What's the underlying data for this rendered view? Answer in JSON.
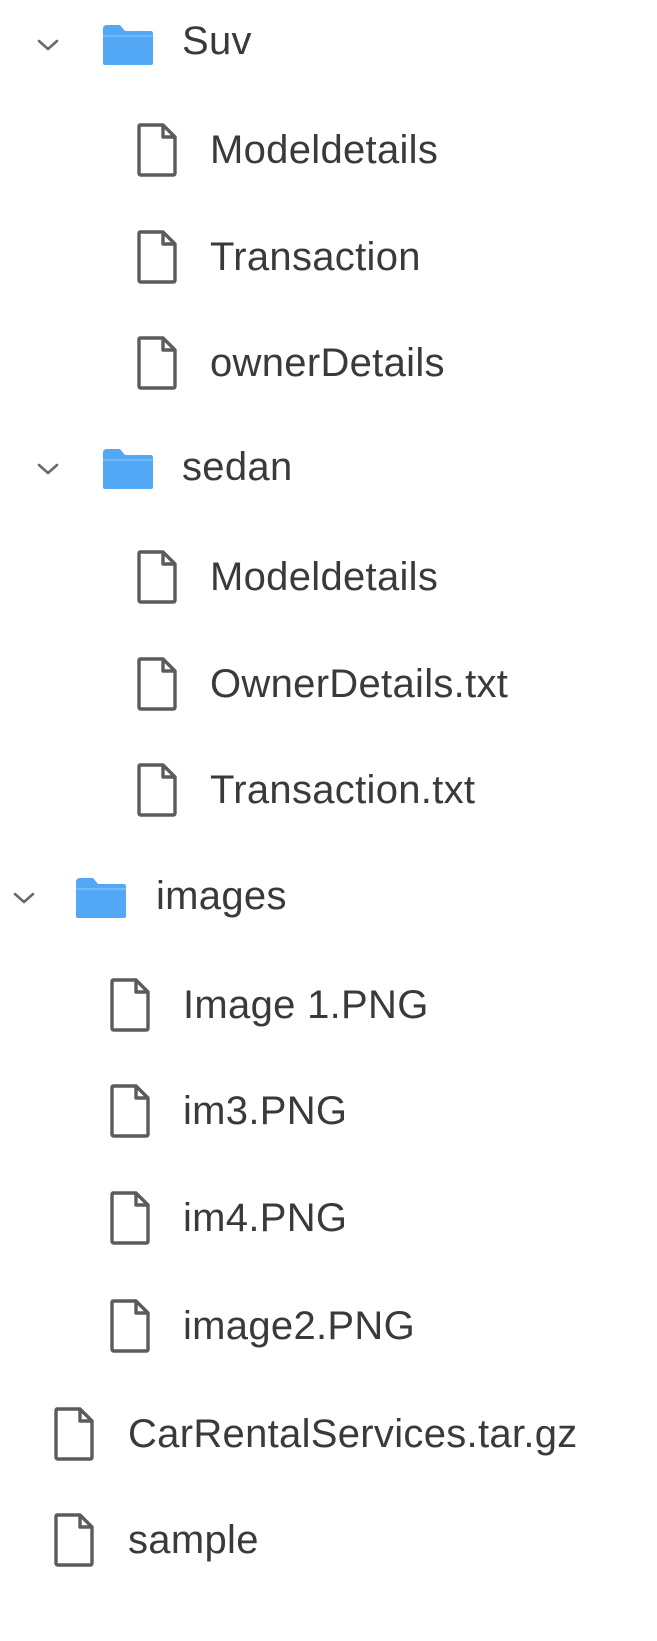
{
  "colors": {
    "folder": "#52a8f5",
    "file_stroke": "#5b5b5b",
    "chevron": "#6a6a6a",
    "text": "#3a3a3a"
  },
  "tree": {
    "suv": {
      "label": "Suv",
      "expanded": true,
      "icon": "folder-icon",
      "children": [
        {
          "label": "Modeldetails",
          "icon": "file-icon"
        },
        {
          "label": "Transaction",
          "icon": "file-icon"
        },
        {
          "label": "ownerDetails",
          "icon": "file-icon"
        }
      ]
    },
    "sedan": {
      "label": "sedan",
      "expanded": true,
      "icon": "folder-icon",
      "children": [
        {
          "label": "Modeldetails",
          "icon": "file-icon"
        },
        {
          "label": "OwnerDetails.txt",
          "icon": "file-icon"
        },
        {
          "label": "Transaction.txt",
          "icon": "file-icon"
        }
      ]
    },
    "images": {
      "label": "images",
      "expanded": true,
      "icon": "folder-icon",
      "children": [
        {
          "label": "Image 1.PNG",
          "icon": "file-icon"
        },
        {
          "label": "im3.PNG",
          "icon": "file-icon"
        },
        {
          "label": "im4.PNG",
          "icon": "file-icon"
        },
        {
          "label": "image2.PNG",
          "icon": "file-icon"
        }
      ]
    },
    "root_files": [
      {
        "label": "CarRentalServices.tar.gz",
        "icon": "file-icon"
      },
      {
        "label": "sample",
        "icon": "file-icon"
      }
    ]
  }
}
